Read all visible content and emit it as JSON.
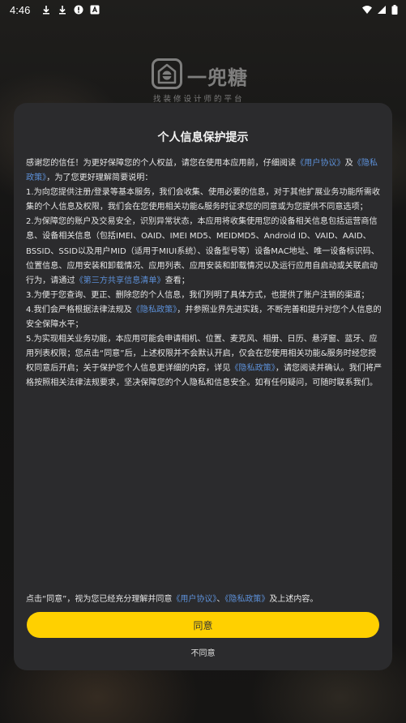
{
  "status_bar": {
    "time": "4:46",
    "icons": [
      "download-icon",
      "download-icon",
      "alert-icon",
      "notification-a-icon",
      "wifi-icon",
      "signal-icon",
      "battery-icon"
    ]
  },
  "background_logo": {
    "brand": "一兜糖",
    "tagline": "找装修设计师的平台"
  },
  "dialog": {
    "title": "个人信息保护提示",
    "paragraphs": [
      [
        {
          "t": "感谢您的信任！为更好保障您的个人权益，请您在使用本应用前，仔细阅读"
        },
        {
          "t": "《用户协议》",
          "link": true
        },
        {
          "t": "及"
        },
        {
          "t": "《隐私政策》",
          "link": true
        },
        {
          "t": "，为了您更好理解简要说明："
        }
      ],
      [
        {
          "t": "1.为向您提供注册/登录等基本服务，我们会收集、使用必要的信息，对于其他扩展业务功能所需收集的个人信息及权限，我们会在您使用相关功能&服务时征求您的同意或为您提供不同意选项；"
        }
      ],
      [
        {
          "t": "2.为保障您的账户及交易安全，识别异常状态，本应用将收集使用您的设备相关信息包括运营商信息、设备相关信息（包括IMEI、OAID、IMEI MD5、MEIDMD5、Android ID、VAID、AAID、BSSID、SSID以及用户MID（适用于MIUI系统）、设备型号等）设备MAC地址、唯一设备标识码、位置信息、应用安装和卸载情况、应用列表、应用安装和卸载情况以及运行应用自启动或关联启动行为，请通过"
        },
        {
          "t": "《第三方共享信息清单》",
          "link": true
        },
        {
          "t": "查看；"
        }
      ],
      [
        {
          "t": "3.为便于您查询、更正、删除您的个人信息，我们列明了具体方式，也提供了账户注销的渠道；"
        }
      ],
      [
        {
          "t": "4.我们会严格根据法律法规及"
        },
        {
          "t": "《隐私政策》",
          "link": true
        },
        {
          "t": "，并参照业界先进实践，不断完善和提升对您个人信息的安全保障水平；"
        }
      ],
      [
        {
          "t": "5.为实现相关业务功能，本应用可能会申请相机、位置、麦克风、相册、日历、悬浮窗、蓝牙、应用列表权限；您点击“同意”后，上述权限并不会默认开启，仅会在您使用相关功能&服务时经您授权同意后开启；关于保护您个人信息更详细的内容，详见"
        },
        {
          "t": "《隐私政策》",
          "link": true
        },
        {
          "t": "，请您阅读并确认。我们将严格按照相关法律法规要求，坚决保障您的个人隐私和信息安全。如有任何疑问，可随时联系我们。"
        }
      ]
    ],
    "consent": [
      {
        "t": "点击“同意”，视为您已经充分理解并同意"
      },
      {
        "t": "《用户协议》",
        "link": true
      },
      {
        "t": "、"
      },
      {
        "t": "《隐私政策》",
        "link": true
      },
      {
        "t": "及上述内容。"
      }
    ],
    "agree_label": "同意",
    "disagree_label": "不同意"
  },
  "colors": {
    "accent": "#ffd000",
    "link": "#5c8fd6",
    "dialog_bg": "#2b2b2d"
  }
}
